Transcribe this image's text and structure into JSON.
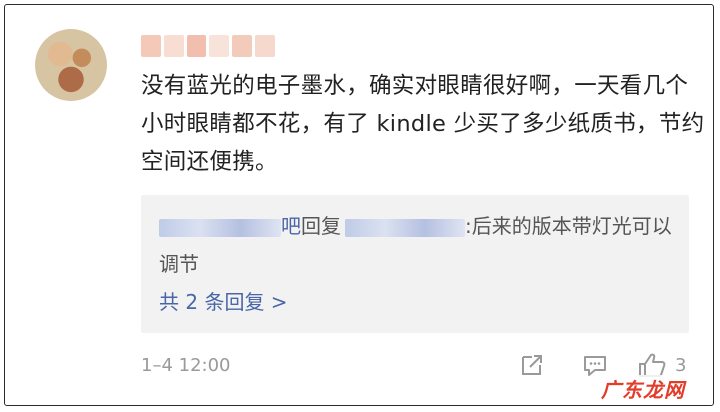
{
  "comment": {
    "text": "没有蓝光的电子墨水，确实对眼睛很好啊，一天看几个小时眼睛都不花，有了 kindle 少买了多少纸质书，节约空间还便携。"
  },
  "reply": {
    "verb": "回复",
    "text": ":后来的版本带灯光可以调节",
    "more": "共 2 条回复 >"
  },
  "meta": {
    "time": "1–4 12:00",
    "like_count": "3"
  },
  "icons": {
    "share": "share-icon",
    "comment": "comment-icon",
    "like": "thumbs-up-icon"
  },
  "colors": {
    "link": "#4a66a8",
    "reply_bg": "#f2f2f2",
    "meta": "#9a9a9a"
  },
  "watermark": "广东龙网"
}
